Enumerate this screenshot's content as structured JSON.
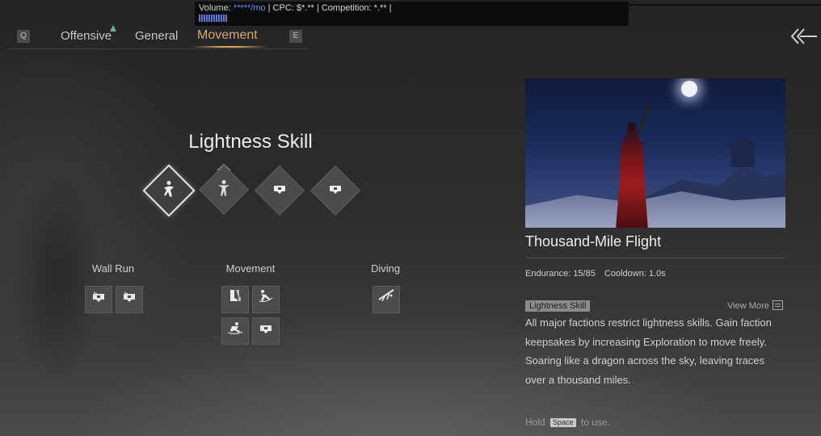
{
  "overlay": {
    "volume_label": "Volume: ",
    "volume_value": "*****/mo",
    "rest": " | CPC: $*.** | Competition: *.** |"
  },
  "tabs": {
    "left_key": "Q",
    "right_key": "E",
    "items": [
      {
        "label": "Offensive"
      },
      {
        "label": "General"
      },
      {
        "label": "Movement",
        "active": true
      }
    ]
  },
  "skill_section": {
    "title": "Lightness Skill",
    "slots": [
      {
        "icon": "leaping-figure-icon",
        "selected": true
      },
      {
        "icon": "running-figure-icon",
        "equipped": true
      },
      {
        "icon": "locked-slot-icon"
      },
      {
        "icon": "locked-slot-icon"
      }
    ]
  },
  "groups": [
    {
      "label": "Wall Run",
      "skills": [
        "locked-icon",
        "locked-icon"
      ]
    },
    {
      "label": "Movement",
      "skills": [
        "boots-icon",
        "dash-icon",
        "roll-icon",
        "locked-icon"
      ]
    },
    {
      "label": "Diving",
      "skills": [
        "dive-icon"
      ]
    }
  ],
  "detail": {
    "name": "Thousand-Mile Flight",
    "endurance": "Endurance: 15/85",
    "cooldown": "Cooldown: 1.0s",
    "tag": "Lightness Skill",
    "view_more": "View More",
    "description": "All major factions restrict lightness skills. Gain faction keepsakes by increasing Exploration to move freely. Soaring like a dragon across the sky, leaving traces over a thousand miles.",
    "hold_prefix": "Hold",
    "hold_key": "Space",
    "hold_suffix": "to use."
  },
  "colors": {
    "accent": "#d7a96a",
    "text": "#d8d8d8",
    "tag_bg": "#8a8b8d"
  }
}
